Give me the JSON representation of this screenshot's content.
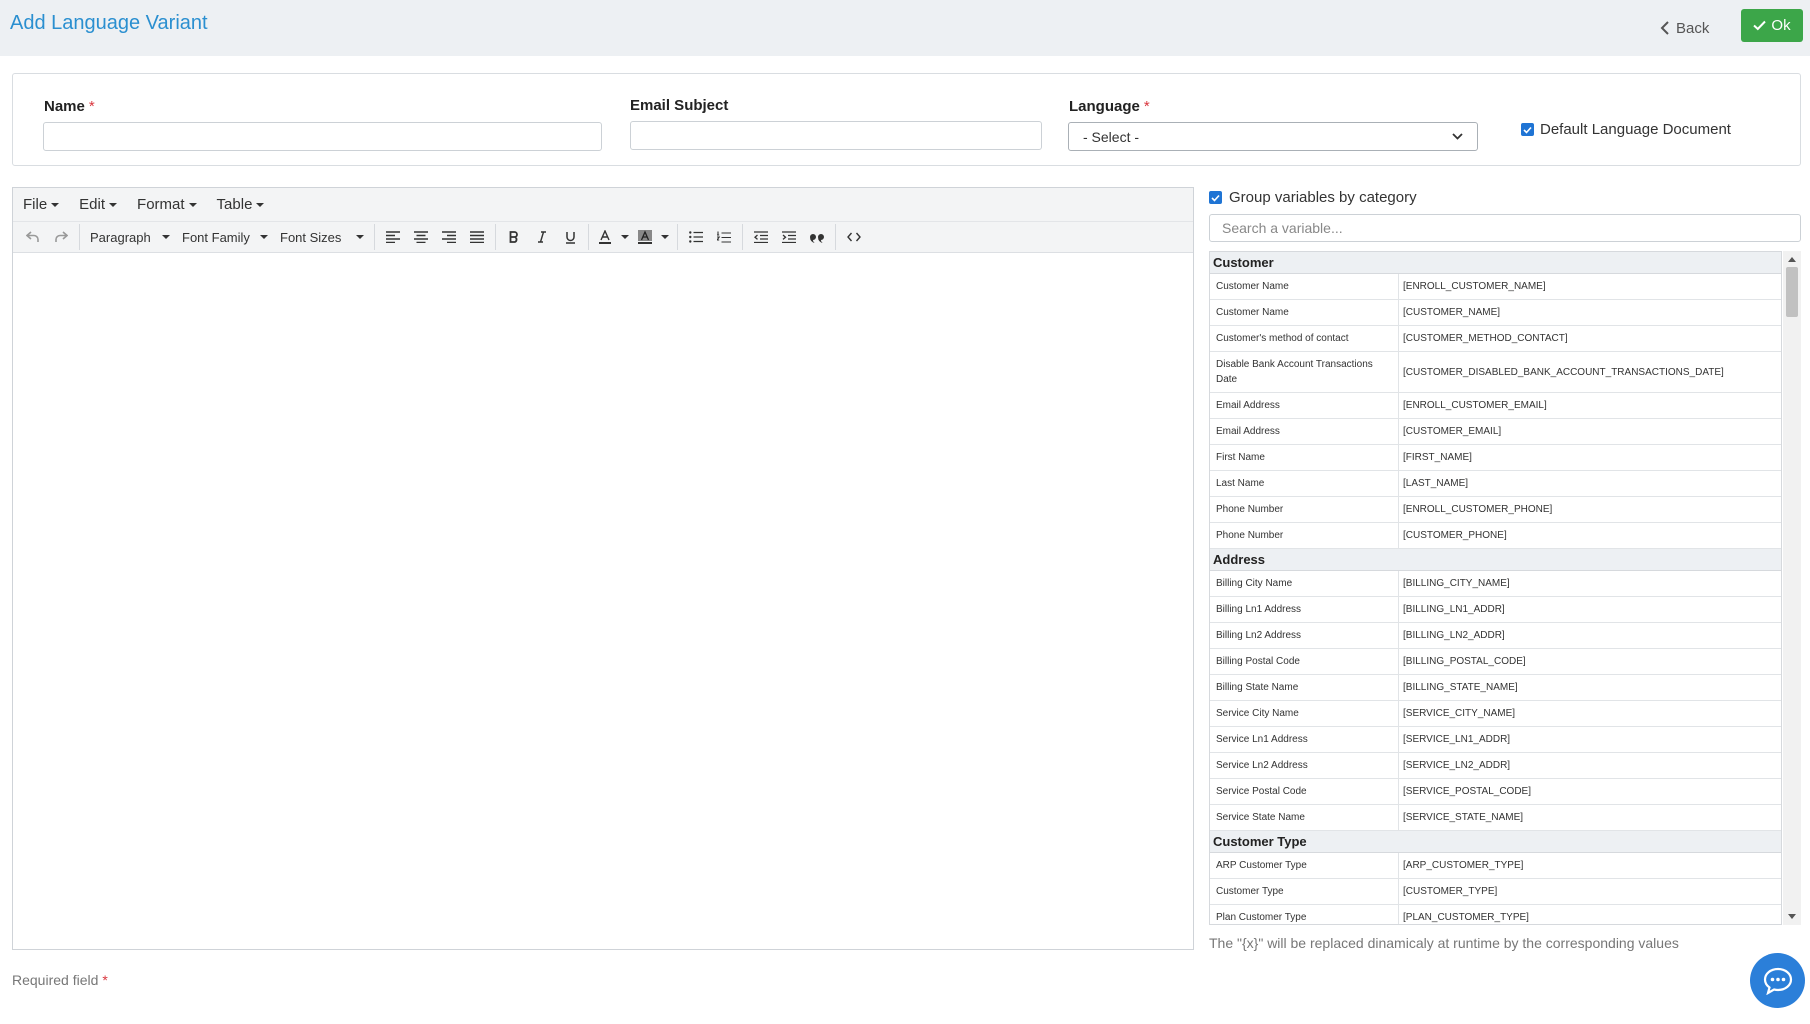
{
  "header": {
    "title": "Add Language Variant",
    "back_label": "Back",
    "ok_label": "Ok"
  },
  "form": {
    "name_label": "Name",
    "name_value": "",
    "email_subject_label": "Email Subject",
    "email_subject_value": "",
    "language_label": "Language",
    "language_selected": "- Select -",
    "required_mark": "*",
    "default_doc_label": "Default Language Document",
    "default_doc_checked": true
  },
  "editor": {
    "menus": [
      "File",
      "Edit",
      "Format",
      "Table"
    ],
    "paragraph_label": "Paragraph",
    "font_family_label": "Font Family",
    "font_sizes_label": "Font Sizes"
  },
  "variables": {
    "group_label": "Group variables by category",
    "group_checked": true,
    "search_placeholder": "Search a variable...",
    "categories": [
      {
        "name": "Customer",
        "items": [
          {
            "label": "Customer Name",
            "token": "[ENROLL_CUSTOMER_NAME]"
          },
          {
            "label": "Customer Name",
            "token": "[CUSTOMER_NAME]"
          },
          {
            "label": "Customer's method of contact",
            "token": "[CUSTOMER_METHOD_CONTACT]"
          },
          {
            "label": "Disable Bank Account Transactions Date",
            "token": "[CUSTOMER_DISABLED_BANK_ACCOUNT_TRANSACTIONS_DATE]"
          },
          {
            "label": "Email Address",
            "token": "[ENROLL_CUSTOMER_EMAIL]"
          },
          {
            "label": "Email Address",
            "token": "[CUSTOMER_EMAIL]"
          },
          {
            "label": "First Name",
            "token": "[FIRST_NAME]"
          },
          {
            "label": "Last Name",
            "token": "[LAST_NAME]"
          },
          {
            "label": "Phone Number",
            "token": "[ENROLL_CUSTOMER_PHONE]"
          },
          {
            "label": "Phone Number",
            "token": "[CUSTOMER_PHONE]"
          }
        ]
      },
      {
        "name": "Address",
        "items": [
          {
            "label": "Billing City Name",
            "token": "[BILLING_CITY_NAME]"
          },
          {
            "label": "Billing Ln1 Address",
            "token": "[BILLING_LN1_ADDR]"
          },
          {
            "label": "Billing Ln2 Address",
            "token": "[BILLING_LN2_ADDR]"
          },
          {
            "label": "Billing Postal Code",
            "token": "[BILLING_POSTAL_CODE]"
          },
          {
            "label": "Billing State Name",
            "token": "[BILLING_STATE_NAME]"
          },
          {
            "label": "Service City Name",
            "token": "[SERVICE_CITY_NAME]"
          },
          {
            "label": "Service Ln1 Address",
            "token": "[SERVICE_LN1_ADDR]"
          },
          {
            "label": "Service Ln2 Address",
            "token": "[SERVICE_LN2_ADDR]"
          },
          {
            "label": "Service Postal Code",
            "token": "[SERVICE_POSTAL_CODE]"
          },
          {
            "label": "Service State Name",
            "token": "[SERVICE_STATE_NAME]"
          }
        ]
      },
      {
        "name": "Customer Type",
        "items": [
          {
            "label": "ARP Customer Type",
            "token": "[ARP_CUSTOMER_TYPE]"
          },
          {
            "label": "Customer Type",
            "token": "[CUSTOMER_TYPE]"
          },
          {
            "label": "Plan Customer Type",
            "token": "[PLAN_CUSTOMER_TYPE]"
          }
        ]
      }
    ],
    "hint": "The \"{x}\" will be replaced dinamicaly at runtime by the corresponding values"
  },
  "footer": {
    "required_note": "Required field"
  },
  "colors": {
    "accent": "#2a8fd0",
    "ok_green": "#3ca649",
    "required_red": "#d9363e",
    "checkbox_blue": "#1f74d4",
    "chat_blue": "#2b7fd9"
  },
  "icons": {
    "back": "chevron-left-icon",
    "ok": "check-icon",
    "chat": "chat-bubble-icon"
  }
}
